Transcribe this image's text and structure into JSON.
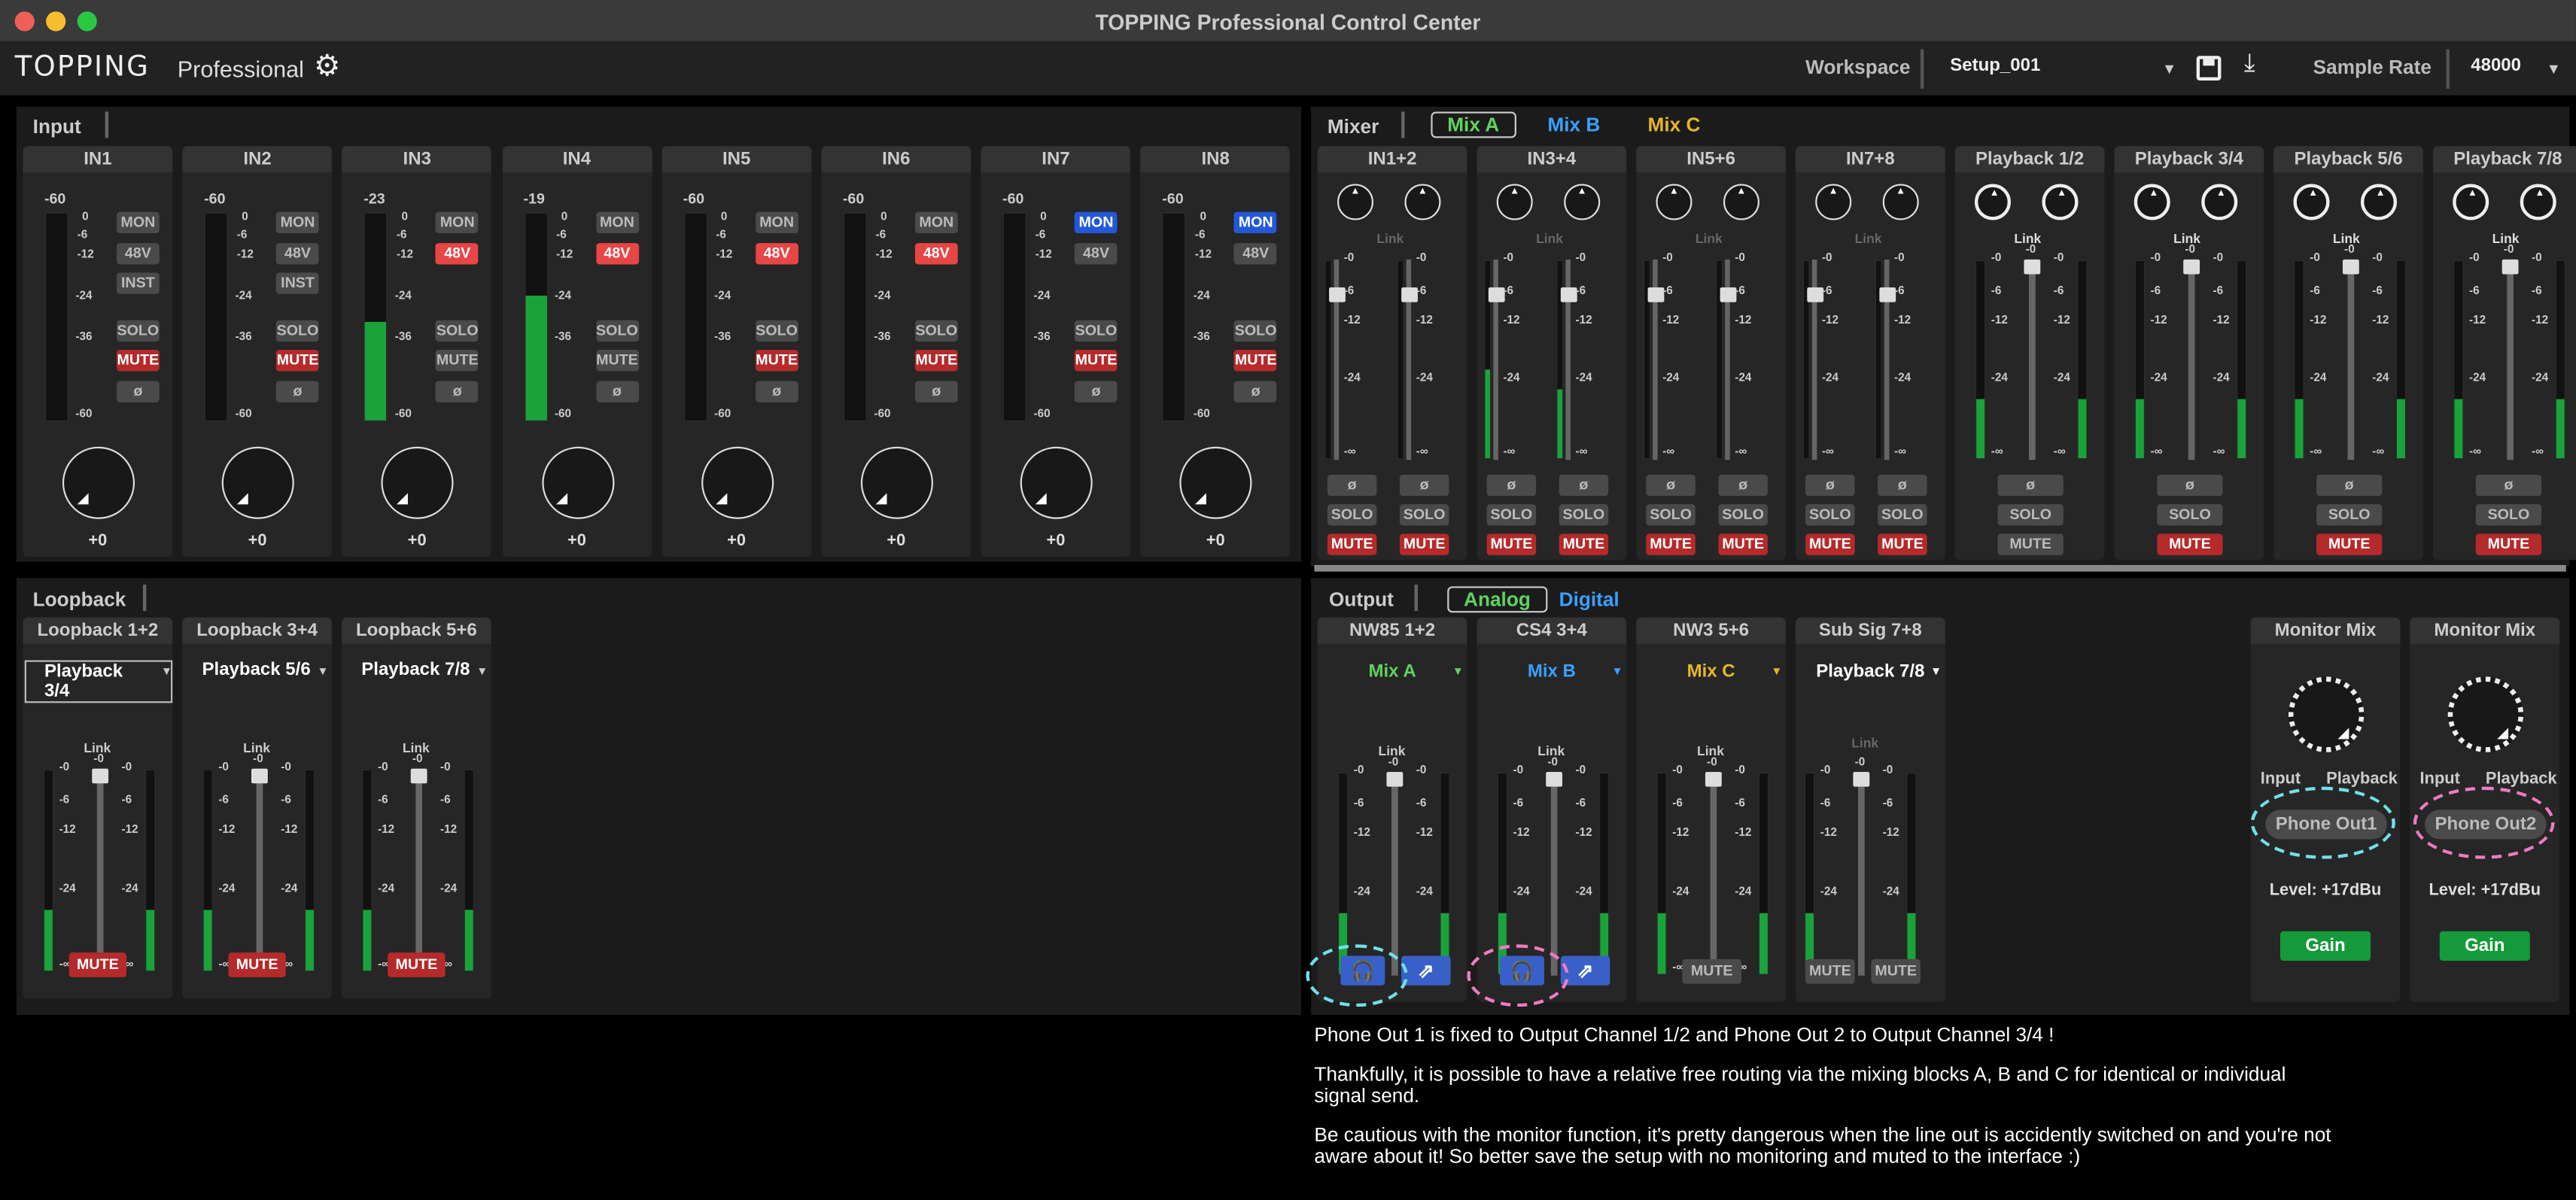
{
  "window": {
    "title": "TOPPING Professional Control Center"
  },
  "toolbar": {
    "logo": "TOPPING",
    "logo_sub": "Professional",
    "workspace_label": "Workspace",
    "workspace_value": "Setup_001",
    "sample_rate_label": "Sample Rate",
    "sample_rate_value": "48000"
  },
  "input": {
    "title": "Input",
    "channels": [
      {
        "name": "IN1",
        "peak": "-60",
        "level": 0,
        "inst": true,
        "mon_on": false,
        "p48": false,
        "mute_on": true,
        "gain": "+0"
      },
      {
        "name": "IN2",
        "peak": "-60",
        "level": 0,
        "inst": true,
        "mon_on": false,
        "p48": false,
        "mute_on": true,
        "gain": "+0"
      },
      {
        "name": "IN3",
        "peak": "-23",
        "level": 0.48,
        "inst": false,
        "mon_on": false,
        "p48": true,
        "mute_on": false,
        "gain": "+0"
      },
      {
        "name": "IN4",
        "peak": "-19",
        "level": 0.6,
        "inst": false,
        "mon_on": false,
        "p48": true,
        "mute_on": false,
        "gain": "+0"
      },
      {
        "name": "IN5",
        "peak": "-60",
        "level": 0,
        "inst": false,
        "mon_on": false,
        "p48": true,
        "mute_on": true,
        "gain": "+0"
      },
      {
        "name": "IN6",
        "peak": "-60",
        "level": 0,
        "inst": false,
        "mon_on": false,
        "p48": true,
        "mute_on": true,
        "gain": "+0"
      },
      {
        "name": "IN7",
        "peak": "-60",
        "level": 0,
        "inst": false,
        "mon_on": true,
        "p48": false,
        "mute_on": true,
        "gain": "+0"
      },
      {
        "name": "IN8",
        "peak": "-60",
        "level": 0,
        "inst": false,
        "mon_on": true,
        "p48": false,
        "mute_on": true,
        "gain": "+0"
      }
    ],
    "labels": {
      "mon": "MON",
      "p48": "48V",
      "inst": "INST",
      "solo": "SOLO",
      "mute": "MUTE",
      "phase": "ø"
    },
    "scale": [
      "0",
      "-6",
      "-12",
      "-24",
      "-36",
      "-60"
    ]
  },
  "loopback": {
    "title": "Loopback",
    "channels": [
      {
        "name": "Loopback 1+2",
        "source": "Playback 3/4",
        "mute": "MUTE"
      },
      {
        "name": "Loopback 3+4",
        "source": "Playback 5/6",
        "mute": "MUTE"
      },
      {
        "name": "Loopback 5+6",
        "source": "Playback 7/8",
        "mute": "MUTE"
      }
    ],
    "link": "Link"
  },
  "mixer": {
    "title": "Mixer",
    "tabs": [
      {
        "label": "Mix A",
        "color": "#5fd35f",
        "selected": true
      },
      {
        "label": "Mix B",
        "color": "#3aa0ff",
        "selected": false
      },
      {
        "label": "Mix C",
        "color": "#e6b62c",
        "selected": false
      }
    ],
    "channels": [
      {
        "name": "IN1+2",
        "mute_on": true
      },
      {
        "name": "IN3+4",
        "mute_on": true
      },
      {
        "name": "IN5+6",
        "mute_on": true
      },
      {
        "name": "IN7+8",
        "mute_on": true
      },
      {
        "name": "Playback 1/2",
        "mute_on": false
      },
      {
        "name": "Playback 3/4",
        "mute_on": true
      },
      {
        "name": "Playback 5/6",
        "mute_on": true
      },
      {
        "name": "Playback 7/8",
        "mute_on": true
      }
    ],
    "link": "Link"
  },
  "output": {
    "title": "Output",
    "tabs": [
      {
        "label": "Analog",
        "color": "#5fd35f",
        "selected": true
      },
      {
        "label": "Digital",
        "color": "#3aa0ff",
        "selected": false
      }
    ],
    "channels": [
      {
        "name": "NW85 1+2",
        "source": "Mix A",
        "color": "#5fd35f"
      },
      {
        "name": "CS4 3+4",
        "source": "Mix B",
        "color": "#3aa0ff"
      },
      {
        "name": "NW3 5+6",
        "source": "Mix C",
        "color": "#e6b62c"
      },
      {
        "name": "Sub Sig 7+8",
        "source": "Playback 7/8",
        "color": "#ffffff"
      }
    ],
    "monitor": [
      {
        "name": "Monitor Mix",
        "input": "Input",
        "playback": "Playback",
        "phone": "Phone Out1",
        "level": "Level: +17dBu",
        "gain": "Gain"
      },
      {
        "name": "Monitor Mix",
        "input": "Input",
        "playback": "Playback",
        "phone": "Phone Out2",
        "level": "Level: +17dBu",
        "gain": "Gain"
      }
    ]
  },
  "notes": [
    "Phone Out 1 is fixed to Output Channel 1/2 and Phone Out 2 to Output Channel 3/4 !",
    "Thankfully, it is possible to have a relative free routing via the mixing blocks A, B and C for identical or individual signal send.",
    "Be cautious with the monitor function, it's pretty dangerous when the line out is accidently switched on and you're not aware about it! So better save the setup with no monitoring and muted to the interface :)"
  ],
  "colors": {
    "accent_green": "#1aa33a",
    "mute_red": "#b52a2a",
    "p48_red": "#e84545",
    "mon_blue": "#2358d6",
    "annotation_cyan": "#6fe0ea",
    "annotation_pink": "#f07ac0"
  }
}
